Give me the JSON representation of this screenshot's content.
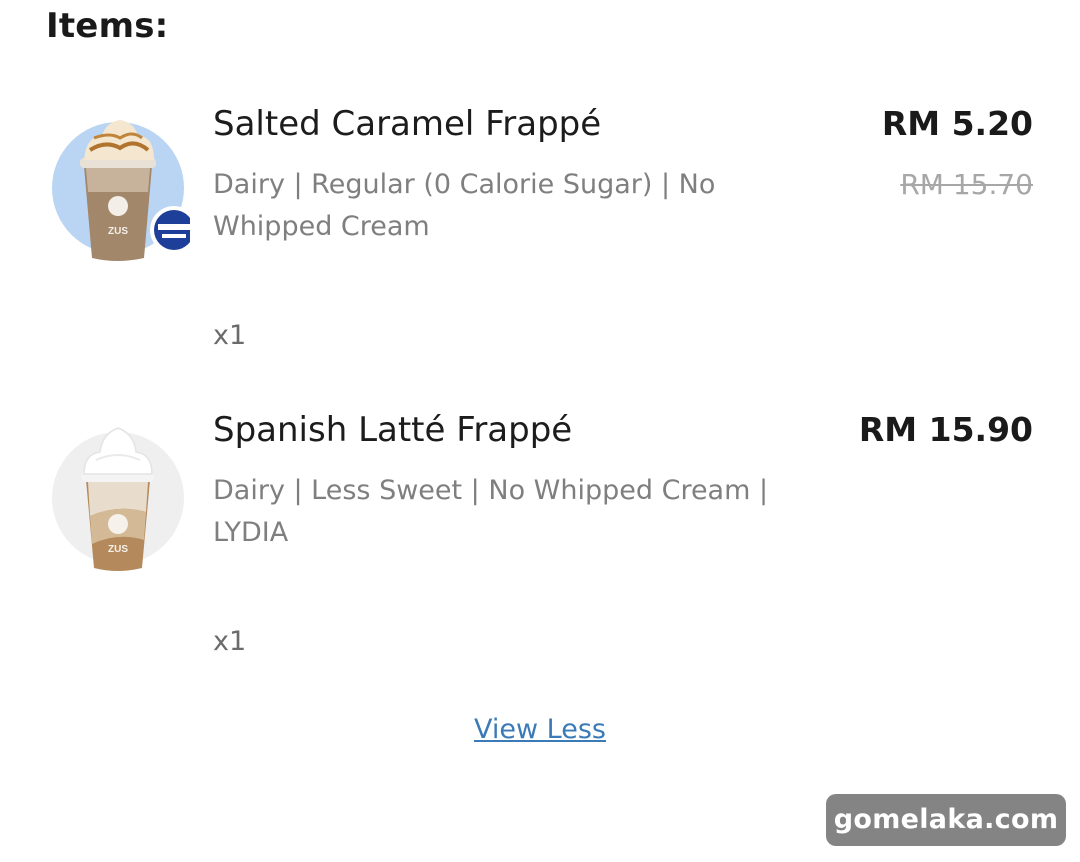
{
  "section": {
    "title": "Items:"
  },
  "items": [
    {
      "name": "Salted Caramel Frappé",
      "options": "Dairy | Regular (0 Calorie Sugar) | No Whipped Cream",
      "quantity": "x1",
      "price": "RM 5.20",
      "original_price": "RM 15.70",
      "image_badge": "zero-calorie-sugar-badge"
    },
    {
      "name": "Spanish Latté Frappé",
      "options": "Dairy | Less Sweet | No Whipped Cream | LYDIA",
      "quantity": "x1",
      "price": "RM 15.90"
    }
  ],
  "actions": {
    "view_less_label": "View Less"
  },
  "watermark": {
    "text": "gomelaka.com"
  },
  "colors": {
    "text_primary": "#1c1c1c",
    "text_secondary": "#7f7f7f",
    "link": "#3a7bb7",
    "strikethrough": "#a7a7a7",
    "thumb_bg_blue": "#b9d5f3",
    "thumb_bg_grey": "#efefef"
  }
}
